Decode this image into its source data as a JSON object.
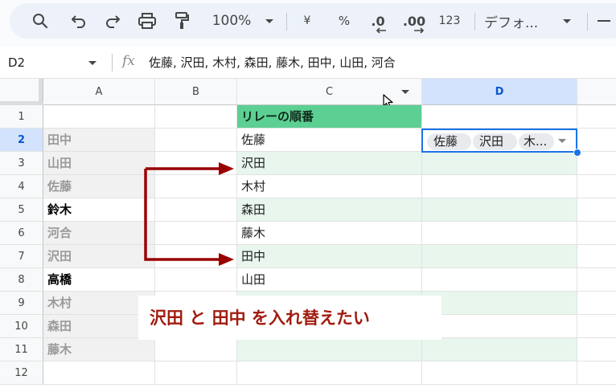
{
  "toolbar": {
    "zoom": "100%",
    "currency": "¥",
    "percent": "%",
    "decrease_decimal": ".0",
    "increase_decimal": ".00",
    "number_format": "123",
    "font": "デフォ..."
  },
  "formula_bar": {
    "cell_ref": "D2",
    "fx": "fx",
    "value": "佐藤, 沢田, 木村, 森田, 藤木, 田中, 山田, 河合"
  },
  "columns": [
    "A",
    "B",
    "C",
    "D"
  ],
  "rows": [
    "1",
    "2",
    "3",
    "4",
    "5",
    "6",
    "7",
    "8",
    "9",
    "10",
    "11",
    "12"
  ],
  "col_a": [
    "田中",
    "山田",
    "佐藤",
    "鈴木",
    "河合",
    "沢田",
    "高橋",
    "木村",
    "森田",
    "藤木"
  ],
  "col_c": {
    "header": "リレーの順番",
    "values": [
      "佐藤",
      "沢田",
      "木村",
      "森田",
      "藤木",
      "田中",
      "山田"
    ]
  },
  "d2_chips": [
    "佐藤",
    "沢田",
    "木..."
  ],
  "annotation": "沢田 と 田中 を入れ替えたい",
  "colors": {
    "header_green": "#5ccf93",
    "band_green": "#e8f6ee",
    "selection_blue": "#1a73e8",
    "arrow_red": "#990000",
    "annotation_red": "#a11b0f"
  }
}
